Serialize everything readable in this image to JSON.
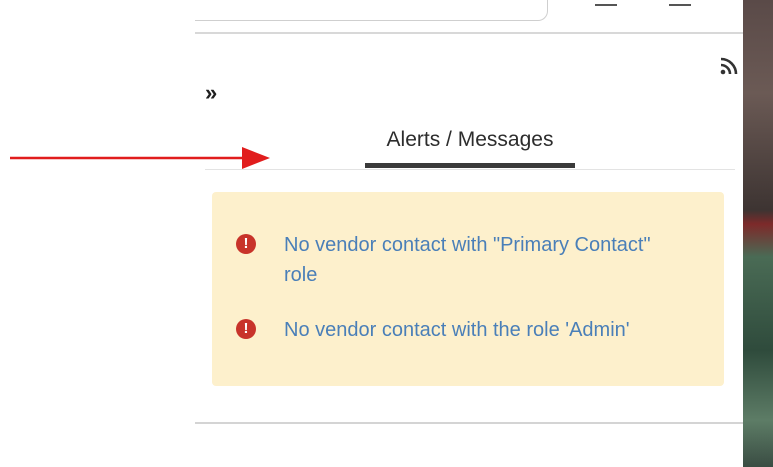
{
  "panel": {
    "collapse_icon_glyph": "»",
    "tab_label": "Alerts / Messages",
    "alerts": [
      {
        "icon": "alert-circle-icon",
        "text": "No vendor contact with \"Primary Contact\" role"
      },
      {
        "icon": "alert-circle-icon",
        "text": "No vendor contact with the role 'Admin'"
      }
    ],
    "alert_icon_glyph": "!"
  },
  "colors": {
    "alert_bg": "#fdf0cc",
    "alert_text": "#4a7fb8",
    "alert_icon": "#c8332a",
    "annotation_arrow": "#e11d1d",
    "tab_underline": "#3a3a3a"
  }
}
